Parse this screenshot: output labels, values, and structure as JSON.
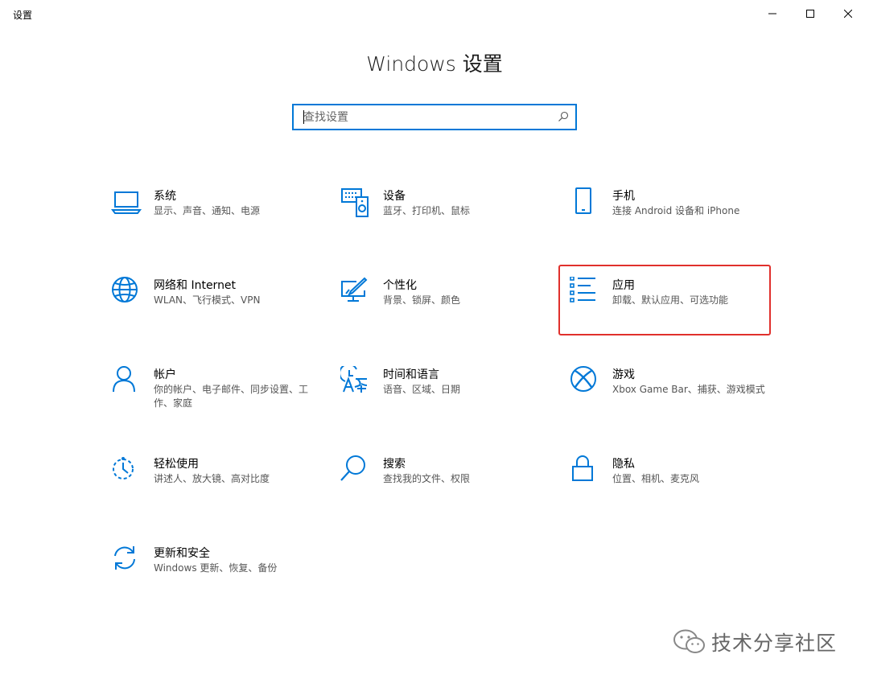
{
  "window": {
    "title": "设置"
  },
  "header": {
    "title": "Windows 设置"
  },
  "search": {
    "placeholder": "查找设置"
  },
  "categories": [
    {
      "title": "系统",
      "desc": "显示、声音、通知、电源",
      "icon": "laptop-icon"
    },
    {
      "title": "设备",
      "desc": "蓝牙、打印机、鼠标",
      "icon": "devices-icon"
    },
    {
      "title": "手机",
      "desc": "连接 Android 设备和 iPhone",
      "icon": "phone-icon"
    },
    {
      "title": "网络和 Internet",
      "desc": "WLAN、飞行模式、VPN",
      "icon": "globe-icon"
    },
    {
      "title": "个性化",
      "desc": "背景、锁屏、颜色",
      "icon": "personalization-icon"
    },
    {
      "title": "应用",
      "desc": "卸载、默认应用、可选功能",
      "icon": "apps-list-icon"
    },
    {
      "title": "帐户",
      "desc": "你的帐户、电子邮件、同步设置、工作、家庭",
      "icon": "person-icon"
    },
    {
      "title": "时间和语言",
      "desc": "语音、区域、日期",
      "icon": "time-language-icon"
    },
    {
      "title": "游戏",
      "desc": "Xbox Game Bar、捕获、游戏模式",
      "icon": "xbox-icon"
    },
    {
      "title": "轻松使用",
      "desc": "讲述人、放大镜、高对比度",
      "icon": "ease-of-access-icon"
    },
    {
      "title": "搜索",
      "desc": "查找我的文件、权限",
      "icon": "search-icon"
    },
    {
      "title": "隐私",
      "desc": "位置、相机、麦克风",
      "icon": "lock-icon"
    },
    {
      "title": "更新和安全",
      "desc": "Windows 更新、恢复、备份",
      "icon": "sync-icon"
    }
  ],
  "watermark": {
    "text": "技术分享社区"
  },
  "colors": {
    "accent": "#0078d7",
    "highlight": "#e0302c"
  }
}
